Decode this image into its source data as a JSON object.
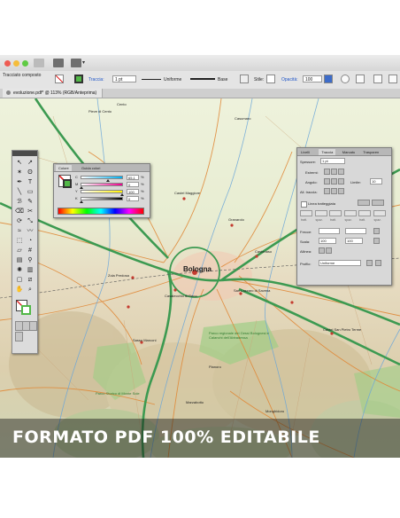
{
  "window": {
    "traffic_lights": [
      "#ee5b52",
      "#f5bd3b",
      "#5fcb44"
    ]
  },
  "control_bar": {
    "object_type": "Tracciato composto",
    "stroke_label": "Traccia:",
    "stroke_weight": "1 pt",
    "profile_value": "Uniforme",
    "brush_value": "Base",
    "style_label": "Stile:",
    "opacity_label": "Opacità:",
    "opacity_value": "100"
  },
  "document_tab": {
    "title": "evoluzione.pdf* @ 113% (RGB/Anteprima)"
  },
  "tools_panel": {
    "tools": [
      "selection-tool",
      "direct-selection-tool",
      "magic-wand-tool",
      "lasso-tool",
      "pen-tool",
      "type-tool",
      "line-tool",
      "rectangle-tool",
      "paintbrush-tool",
      "pencil-tool",
      "eraser-tool",
      "scissors-tool",
      "rotate-tool",
      "scale-tool",
      "width-tool",
      "warp-tool",
      "free-transform-tool",
      "shape-builder-tool",
      "perspective-tool",
      "mesh-tool",
      "gradient-tool",
      "eyedropper-tool",
      "symbol-sprayer-tool",
      "graph-tool",
      "artboard-tool",
      "slice-tool",
      "hand-tool",
      "zoom-tool"
    ]
  },
  "color_panel": {
    "tab_color": "Colore",
    "tab_guide": "Guida colori",
    "channels": [
      {
        "label": "C",
        "value": "65,1",
        "unit": "%",
        "level": 0.65
      },
      {
        "label": "M",
        "value": "0",
        "unit": "%",
        "level": 0.0
      },
      {
        "label": "Y",
        "value": "100",
        "unit": "%",
        "level": 1.0
      },
      {
        "label": "K",
        "value": "0",
        "unit": "%",
        "level": 0.0
      }
    ],
    "fill_color": "#52b848"
  },
  "stroke_panel": {
    "tabs": [
      "Livelli",
      "Traccia",
      "Marcatu",
      "Trasparen"
    ],
    "weight_label": "Spessore:",
    "weight_value": "1 pt",
    "ends_label": "Estremi:",
    "corner_label": "Angolo:",
    "limit_label": "Limite:",
    "limit_value": "10",
    "align_label": "All. traccia:",
    "dashed_label": "Linea tratteggiata",
    "dash_headers": [
      "tratt.",
      "spaz.",
      "tratt.",
      "spaz.",
      "tratt.",
      "spaz."
    ],
    "arrows_label": "Frecce:",
    "scale_label": "Scala:",
    "scale_values": [
      "100",
      "100"
    ],
    "align_arrow_label": "Allinea:",
    "profile_label": "Profilo:",
    "profile_value": "Uniforme"
  },
  "map": {
    "main_city": "Bologna",
    "places": [
      "Cento",
      "Pieve di Cento",
      "Casumaro",
      "San Giovanni in Persiceto",
      "Castel Maggiore",
      "Castenaso",
      "Granarolo",
      "Budrio",
      "Medicina",
      "Crespellano",
      "Zola Predosa",
      "Casalecchio di Reno",
      "Sasso Marconi",
      "San Lazzaro di Savena",
      "Ozzano dell'Emilia",
      "Castel San Pietro Terme",
      "Pianoro",
      "Monzuno",
      "Loiano",
      "Monghidoro",
      "Marzabotto",
      "Vergato",
      "Grizzana",
      "Castiglione dei Pepoli",
      "Imola",
      "Parco regionale dei Gessi Bolognesi e Calanchi dell'Abbadessa",
      "Parco Storico di Monte Sole",
      "Monterenzio",
      "Dozza"
    ]
  },
  "banner": {
    "text": "FORMATO PDF 100% EDITABILE"
  }
}
